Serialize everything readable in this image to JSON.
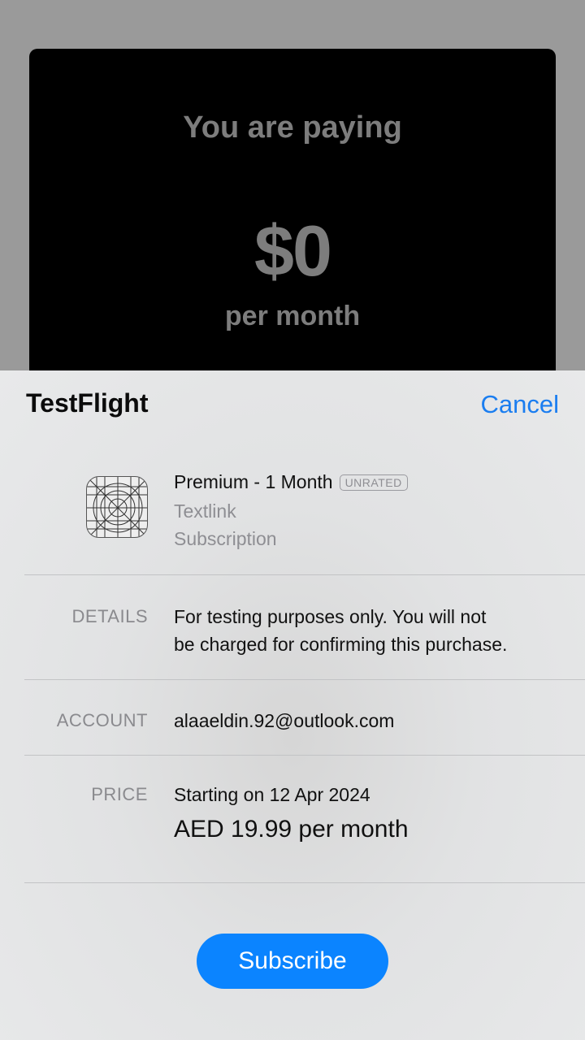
{
  "background": {
    "title": "You are paying",
    "amount": "$0",
    "period": "per month"
  },
  "sheet": {
    "app_title": "TestFlight",
    "cancel_label": "Cancel",
    "product": {
      "name": "Premium - 1 Month",
      "rating": "UNRATED",
      "app_name": "Textlink",
      "type": "Subscription",
      "icon": "app-placeholder-icon"
    },
    "details": {
      "label": "DETAILS",
      "line1": "For testing purposes only. You will not",
      "line2": "be charged for confirming this purchase."
    },
    "account": {
      "label": "ACCOUNT",
      "value": "alaaeldin.92@outlook.com"
    },
    "price": {
      "label": "PRICE",
      "start": "Starting on 12 Apr 2024",
      "amount": "AED 19.99 per month"
    },
    "subscribe_label": "Subscribe"
  },
  "colors": {
    "accent": "#0b84ff",
    "link": "#1a7df0",
    "secondary_text": "#8e8e93"
  }
}
